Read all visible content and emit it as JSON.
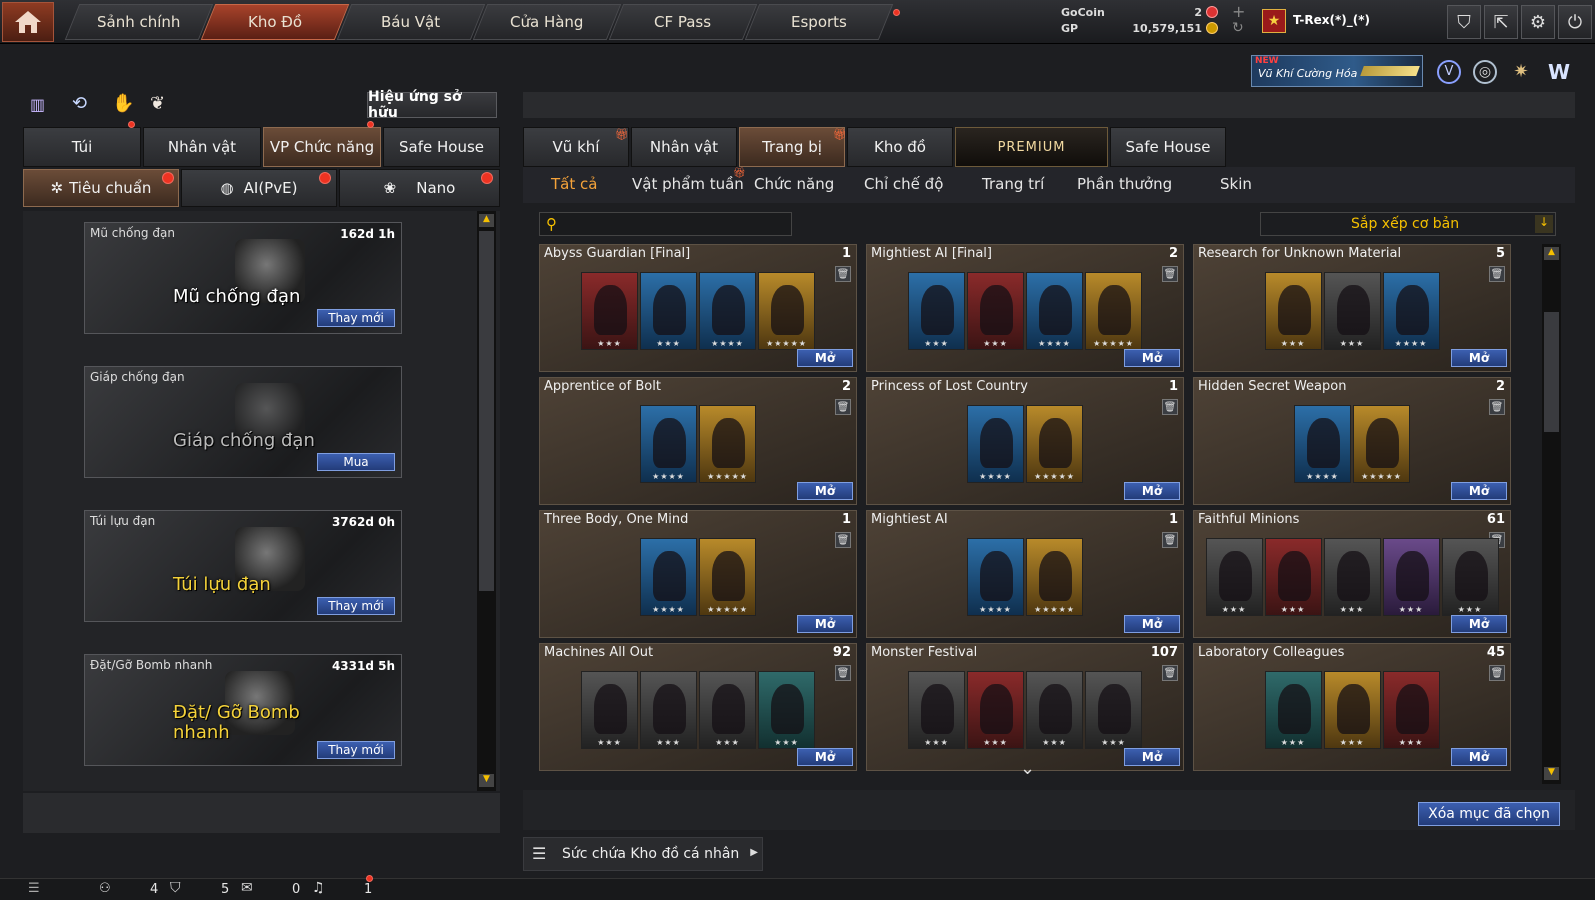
{
  "nav": {
    "tabs": [
      {
        "label": "Sảnh chính"
      },
      {
        "label": "Kho Đồ"
      },
      {
        "label": "Báu Vật"
      },
      {
        "label": "Cửa Hàng"
      },
      {
        "label": "CF Pass"
      },
      {
        "label": "Esports"
      }
    ],
    "currency": {
      "gocoin_label": "GoCoin",
      "gocoin_value": "2",
      "gp_label": "GP",
      "gp_value": "10,579,151"
    },
    "username": "T-Rex(*)_(*)"
  },
  "banner": {
    "badge": "NEW",
    "text": "Vũ Khí Cường Hóa"
  },
  "left": {
    "effects_button": "Hiệu ứng sở hữu",
    "tabs": [
      "Túi",
      "Nhân vật",
      "VP Chức năng",
      "Safe House"
    ],
    "modes": [
      "Tiêu chuẩn",
      "AI(PvE)",
      "Nano"
    ],
    "slots": [
      {
        "name": "Mũ chống đạn",
        "time": "162d 1h",
        "big": "Mũ chống đạn",
        "action": "Thay mới"
      },
      {
        "name": "Giáp chống đạn",
        "time": "",
        "big": "Giáp chống đạn",
        "action": "Mua"
      },
      {
        "name": "Túi lựu đạn",
        "time": "3762d 0h",
        "big": "Túi lựu đạn",
        "action": "Thay mới"
      },
      {
        "name": "Đặt/Gỡ Bomb nhanh",
        "time": "4331d 5h",
        "big": "Đặt/ Gỡ Bomb nhanh",
        "action": "Thay mới"
      }
    ]
  },
  "right": {
    "tabs": [
      "Vũ khí",
      "Nhân vật",
      "Trang bị",
      "Kho đồ",
      "PREMIUM",
      "Safe House"
    ],
    "subtabs": [
      "Tất cả",
      "Vật phẩm tuần",
      "Chức năng",
      "Chỉ chế độ",
      "Trang trí",
      "Phần thưởng",
      "Skin"
    ],
    "search_placeholder": "",
    "sort_label": "Sắp xếp cơ bản",
    "open_label": "Mở",
    "cards": [
      {
        "title": "Abyss Guardian [Final]",
        "count": "1",
        "thumbs": [
          {
            "c": "r",
            "s": "★★★"
          },
          {
            "c": "b",
            "s": "★★★"
          },
          {
            "c": "b",
            "s": "★★★★"
          },
          {
            "c": "g",
            "s": "★★★★★"
          }
        ]
      },
      {
        "title": "Mightiest AI [Final]",
        "count": "2",
        "thumbs": [
          {
            "c": "b",
            "s": "★★★"
          },
          {
            "c": "r",
            "s": "★★★"
          },
          {
            "c": "b",
            "s": "★★★★"
          },
          {
            "c": "g",
            "s": "★★★★★"
          }
        ]
      },
      {
        "title": "Research for Unknown Material",
        "count": "5",
        "thumbs": [
          {
            "c": "g",
            "s": "★★★"
          },
          {
            "c": "d",
            "s": "★★★"
          },
          {
            "c": "b",
            "s": "★★★★"
          }
        ]
      },
      {
        "title": "Apprentice of Bolt",
        "count": "2",
        "thumbs": [
          {
            "c": "b",
            "s": "★★★★"
          },
          {
            "c": "g",
            "s": "★★★★★"
          }
        ]
      },
      {
        "title": "Princess of Lost Country",
        "count": "1",
        "thumbs": [
          {
            "c": "b",
            "s": "★★★★"
          },
          {
            "c": "g",
            "s": "★★★★★"
          }
        ]
      },
      {
        "title": "Hidden Secret Weapon",
        "count": "2",
        "thumbs": [
          {
            "c": "b",
            "s": "★★★★"
          },
          {
            "c": "g",
            "s": "★★★★★"
          }
        ]
      },
      {
        "title": "Three Body, One Mind",
        "count": "1",
        "thumbs": [
          {
            "c": "b",
            "s": "★★★★"
          },
          {
            "c": "g",
            "s": "★★★★★"
          }
        ]
      },
      {
        "title": "Mightiest AI",
        "count": "1",
        "thumbs": [
          {
            "c": "b",
            "s": "★★★★"
          },
          {
            "c": "g",
            "s": "★★★★★"
          }
        ]
      },
      {
        "title": "Faithful Minions",
        "count": "61",
        "thumbs": [
          {
            "c": "d",
            "s": "★★★"
          },
          {
            "c": "r",
            "s": "★★★"
          },
          {
            "c": "d",
            "s": "★★★"
          },
          {
            "c": "p",
            "s": "★★★"
          },
          {
            "c": "d",
            "s": "★★★"
          }
        ]
      },
      {
        "title": "Machines All Out",
        "count": "92",
        "thumbs": [
          {
            "c": "d",
            "s": "★★★"
          },
          {
            "c": "d",
            "s": "★★★"
          },
          {
            "c": "d",
            "s": "★★★"
          },
          {
            "c": "t",
            "s": "★★★"
          }
        ]
      },
      {
        "title": "Monster Festival",
        "count": "107",
        "thumbs": [
          {
            "c": "d",
            "s": "★★★"
          },
          {
            "c": "r",
            "s": "★★★"
          },
          {
            "c": "d",
            "s": "★★★"
          },
          {
            "c": "d",
            "s": "★★★"
          }
        ]
      },
      {
        "title": "Laboratory Colleagues",
        "count": "45",
        "thumbs": [
          {
            "c": "t",
            "s": "★★★"
          },
          {
            "c": "g",
            "s": "★★★"
          },
          {
            "c": "r",
            "s": "★★★"
          }
        ]
      }
    ],
    "delete_button": "Xóa mục đã chọn",
    "capacity_label": "Sức chứa Kho đồ cá nhân"
  },
  "status": {
    "val1": "4",
    "val2": "5",
    "val3": "0",
    "val4": "1"
  }
}
